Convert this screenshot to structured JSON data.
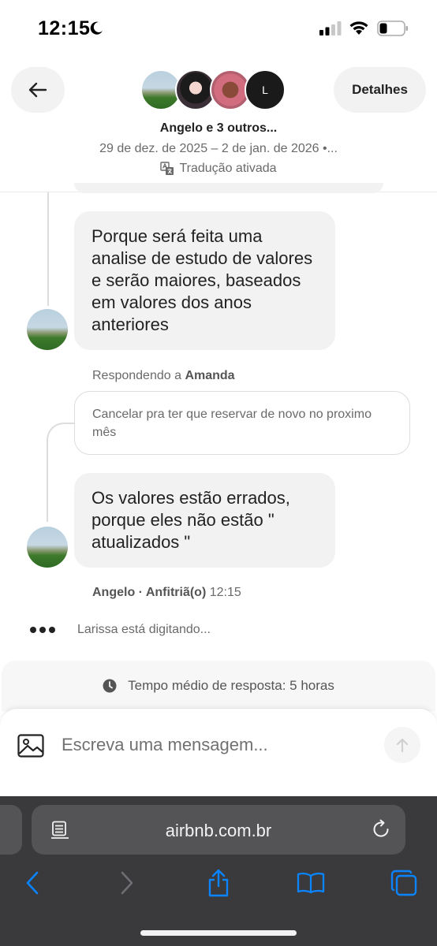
{
  "status_bar": {
    "time": "12:15"
  },
  "header": {
    "back_label": "",
    "details_label": "Detalhes",
    "avatar_initial": "L",
    "title": "Angelo e 3 outros...",
    "dates": "29 de dez. de 2025 – 2 de jan. de 2026 •...",
    "translation": "Tradução ativada"
  },
  "messages": [
    {
      "text": "Porque será feita uma analise de estudo de valores e serão maiores, baseados em valores dos anos anteriores"
    },
    {
      "text": "Os valores estão errados, porque eles não estão \" atualizados \""
    }
  ],
  "reply": {
    "prefix": "Respondendo a ",
    "name": "Amanda",
    "quoted_text": "Cancelar pra ter que reservar de novo no proximo mês"
  },
  "sender_meta": {
    "name_role": "Angelo · Anfitriã(o)",
    "time": "12:15"
  },
  "typing": {
    "text": "Larissa está digitando..."
  },
  "response_time": {
    "text": "Tempo médio de resposta: 5 horas"
  },
  "composer": {
    "placeholder": "Escreva uma mensagem..."
  },
  "browser": {
    "url": "airbnb.com.br"
  },
  "colors": {
    "ios_blue": "#0a84ff",
    "bubble_bg": "#f2f2f2",
    "safari_bar": "#3a3a3c"
  }
}
